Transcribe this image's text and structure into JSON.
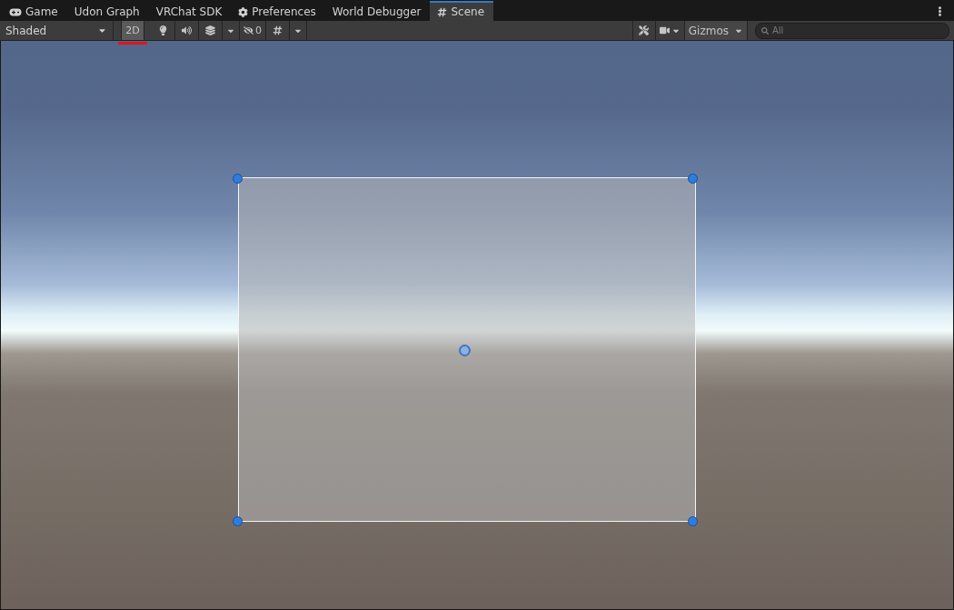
{
  "tabs": [
    {
      "label": "Game",
      "selected": false
    },
    {
      "label": "Udon Graph",
      "selected": false
    },
    {
      "label": "VRChat SDK",
      "selected": false
    },
    {
      "label": "Preferences",
      "selected": false
    },
    {
      "label": "World Debugger",
      "selected": false
    },
    {
      "label": "Scene",
      "selected": true
    }
  ],
  "toolbar": {
    "draw_mode": "Shaded",
    "mode_2d": {
      "label": "2D",
      "on": true,
      "annotated": true
    },
    "hidden_count": "0",
    "gizmos": "Gizmos",
    "search": {
      "placeholder": "All"
    }
  }
}
